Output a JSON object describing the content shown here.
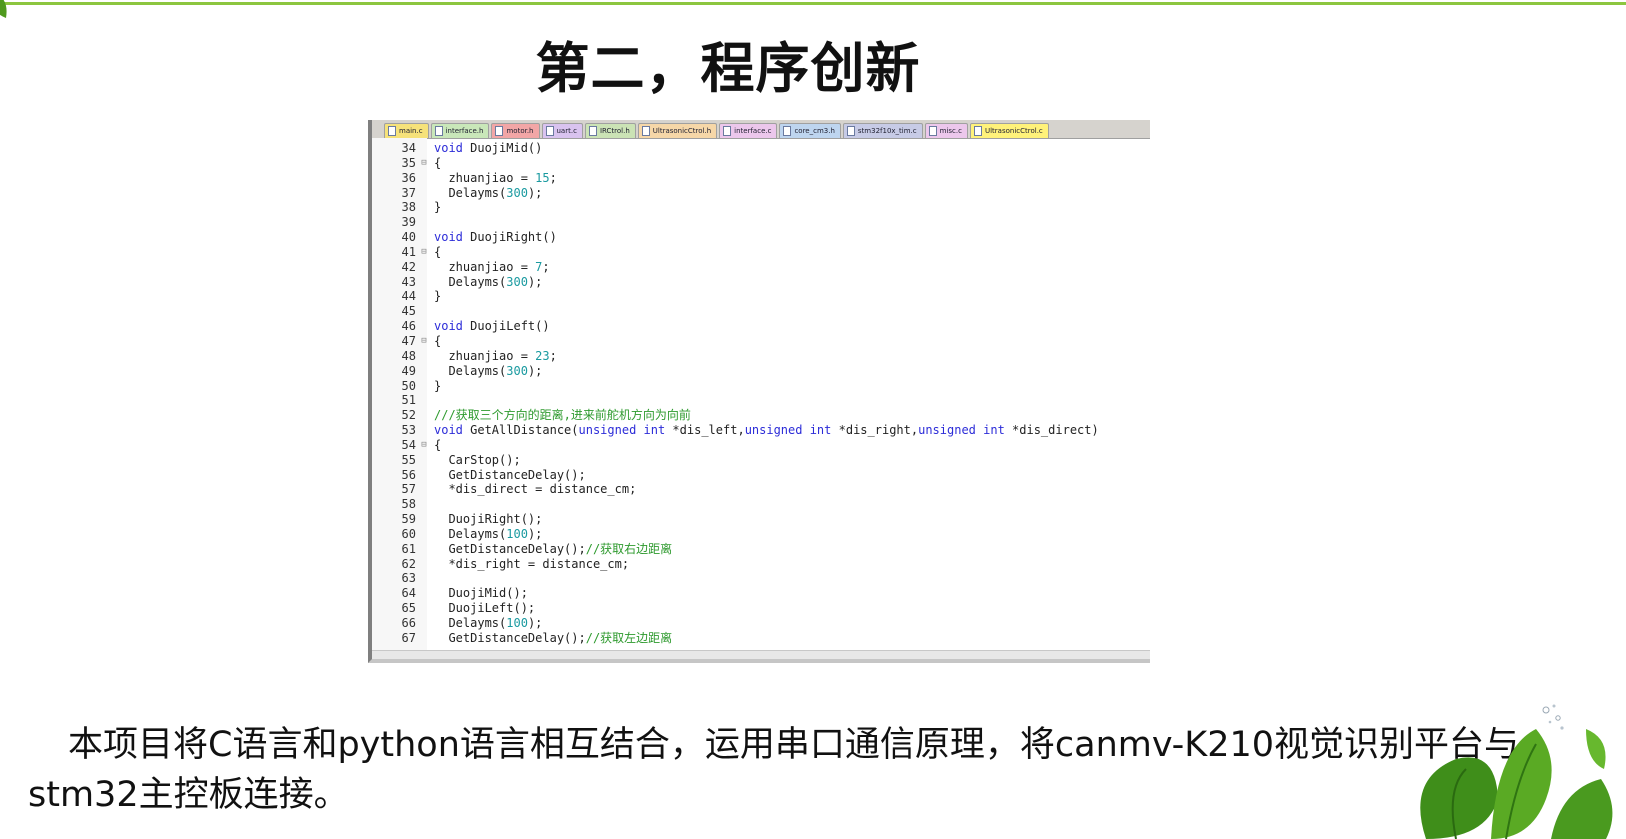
{
  "slide": {
    "title": "第二，程序创新",
    "description": "本项目将C语言和python语言相互结合，运用串口通信原理，将canmv-K210视觉识别平台与stm32主控板连接。"
  },
  "code_window": {
    "tabs": [
      {
        "label": "main.c",
        "color": "#f6e27a"
      },
      {
        "label": "interface.h",
        "color": "#c9e7b9"
      },
      {
        "label": "motor.h",
        "color": "#f2a6a6"
      },
      {
        "label": "uart.c",
        "color": "#d9c3ef"
      },
      {
        "label": "IRCtrol.h",
        "color": "#cbe3b5"
      },
      {
        "label": "UltrasonicCtrol.h",
        "color": "#f6d7a8"
      },
      {
        "label": "interface.c",
        "color": "#ecc7ec"
      },
      {
        "label": "core_cm3.h",
        "color": "#bed5ef"
      },
      {
        "label": "stm32f10x_tim.c",
        "color": "#c7cbe6"
      },
      {
        "label": "misc.c",
        "color": "#ecc7ec"
      },
      {
        "label": "UltrasonicCtrol.c",
        "color": "#fff27a"
      }
    ],
    "lines": [
      {
        "n": "34",
        "f": "",
        "t": [
          [
            "kw",
            "void"
          ],
          [
            "p",
            " DuojiMid()"
          ]
        ]
      },
      {
        "n": "35",
        "f": "⊟",
        "t": [
          [
            "p",
            "{"
          ]
        ]
      },
      {
        "n": "36",
        "f": "",
        "t": [
          [
            "p",
            "  zhuanjiao = "
          ],
          [
            "num",
            "15"
          ],
          [
            "p",
            ";"
          ]
        ]
      },
      {
        "n": "37",
        "f": "",
        "t": [
          [
            "p",
            "  Delayms("
          ],
          [
            "num",
            "300"
          ],
          [
            "p",
            ");"
          ]
        ]
      },
      {
        "n": "38",
        "f": "",
        "t": [
          [
            "p",
            "}"
          ]
        ]
      },
      {
        "n": "39",
        "f": "",
        "t": []
      },
      {
        "n": "40",
        "f": "",
        "t": [
          [
            "kw",
            "void"
          ],
          [
            "p",
            " DuojiRight()"
          ]
        ]
      },
      {
        "n": "41",
        "f": "⊟",
        "t": [
          [
            "p",
            "{"
          ]
        ]
      },
      {
        "n": "42",
        "f": "",
        "t": [
          [
            "p",
            "  zhuanjiao = "
          ],
          [
            "num",
            "7"
          ],
          [
            "p",
            ";"
          ]
        ]
      },
      {
        "n": "43",
        "f": "",
        "t": [
          [
            "p",
            "  Delayms("
          ],
          [
            "num",
            "300"
          ],
          [
            "p",
            ");"
          ]
        ]
      },
      {
        "n": "44",
        "f": "",
        "t": [
          [
            "p",
            "}"
          ]
        ]
      },
      {
        "n": "45",
        "f": "",
        "t": []
      },
      {
        "n": "46",
        "f": "",
        "t": [
          [
            "kw",
            "void"
          ],
          [
            "p",
            " DuojiLeft()"
          ]
        ]
      },
      {
        "n": "47",
        "f": "⊟",
        "t": [
          [
            "p",
            "{"
          ]
        ]
      },
      {
        "n": "48",
        "f": "",
        "t": [
          [
            "p",
            "  zhuanjiao = "
          ],
          [
            "num",
            "23"
          ],
          [
            "p",
            ";"
          ]
        ]
      },
      {
        "n": "49",
        "f": "",
        "t": [
          [
            "p",
            "  Delayms("
          ],
          [
            "num",
            "300"
          ],
          [
            "p",
            ");"
          ]
        ]
      },
      {
        "n": "50",
        "f": "",
        "t": [
          [
            "p",
            "}"
          ]
        ]
      },
      {
        "n": "51",
        "f": "",
        "t": []
      },
      {
        "n": "52",
        "f": "",
        "t": [
          [
            "cmt",
            "///获取三个方向的距离,进来前舵机方向为向前"
          ]
        ]
      },
      {
        "n": "53",
        "f": "",
        "t": [
          [
            "kw",
            "void"
          ],
          [
            "p",
            " GetAllDistance("
          ],
          [
            "kw",
            "unsigned int"
          ],
          [
            "p",
            " *dis_left,"
          ],
          [
            "kw",
            "unsigned int"
          ],
          [
            "p",
            " *dis_right,"
          ],
          [
            "kw",
            "unsigned int"
          ],
          [
            "p",
            " *dis_direct)"
          ]
        ]
      },
      {
        "n": "54",
        "f": "⊟",
        "t": [
          [
            "p",
            "{"
          ]
        ]
      },
      {
        "n": "55",
        "f": "",
        "t": [
          [
            "p",
            "  CarStop();"
          ]
        ]
      },
      {
        "n": "56",
        "f": "",
        "t": [
          [
            "p",
            "  GetDistanceDelay();"
          ]
        ]
      },
      {
        "n": "57",
        "f": "",
        "t": [
          [
            "p",
            "  *dis_direct = distance_cm;"
          ]
        ]
      },
      {
        "n": "58",
        "f": "",
        "t": []
      },
      {
        "n": "59",
        "f": "",
        "t": [
          [
            "p",
            "  DuojiRight();"
          ]
        ]
      },
      {
        "n": "60",
        "f": "",
        "t": [
          [
            "p",
            "  Delayms("
          ],
          [
            "num",
            "100"
          ],
          [
            "p",
            ");"
          ]
        ]
      },
      {
        "n": "61",
        "f": "",
        "t": [
          [
            "p",
            "  GetDistanceDelay();"
          ],
          [
            "cmt",
            "//获取右边距离"
          ]
        ]
      },
      {
        "n": "62",
        "f": "",
        "t": [
          [
            "p",
            "  *dis_right = distance_cm;"
          ]
        ]
      },
      {
        "n": "63",
        "f": "",
        "t": []
      },
      {
        "n": "64",
        "f": "",
        "t": [
          [
            "p",
            "  DuojiMid();"
          ]
        ]
      },
      {
        "n": "65",
        "f": "",
        "t": [
          [
            "p",
            "  DuojiLeft();"
          ]
        ]
      },
      {
        "n": "66",
        "f": "",
        "t": [
          [
            "p",
            "  Delayms("
          ],
          [
            "num",
            "100"
          ],
          [
            "p",
            ");"
          ]
        ]
      },
      {
        "n": "67",
        "f": "",
        "t": [
          [
            "p",
            "  GetDistanceDelay();"
          ],
          [
            "cmt",
            "//获取左边距离"
          ]
        ]
      }
    ]
  },
  "decor": {
    "accent_line_color": "#8cc63f",
    "leaf_color": "#4f9a1e"
  }
}
